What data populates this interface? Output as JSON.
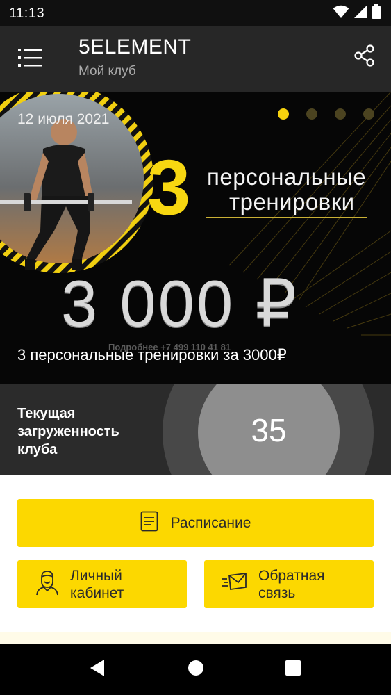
{
  "status_bar": {
    "time": "11:13",
    "icons": [
      "wifi-icon",
      "signal-icon",
      "battery-icon"
    ]
  },
  "app_bar": {
    "title": "5ELEMENT",
    "subtitle": "Мой клуб",
    "menu_icon": "hamburger-menu-icon",
    "share_icon": "share-icon"
  },
  "banner": {
    "date": "12 июля 2021",
    "slides_total": 4,
    "active_slide": 1,
    "promo_number": "3",
    "promo_line1": "персональные",
    "promo_line2": "тренировки",
    "promo_price": "3 000 ₽",
    "promo_phone": "Подробнее +7 499 110 41 81",
    "caption": "3 персональные тренировки за 3000₽"
  },
  "occupancy": {
    "label": "Текущая загруженность клуба",
    "value": "35"
  },
  "actions": {
    "schedule_label": "Расписание",
    "cabinet_label_line1": "Личный",
    "cabinet_label_line2": "кабинет",
    "feedback_label_line1": "Обратная",
    "feedback_label_line2": "связь"
  },
  "colors": {
    "accent": "#fcd800",
    "app_bar": "#272727",
    "status_bar": "#101010",
    "occupancy_bg": "#2b2b2b"
  },
  "nav_bar": {
    "icons": [
      "back-icon",
      "home-icon",
      "recents-icon"
    ]
  }
}
